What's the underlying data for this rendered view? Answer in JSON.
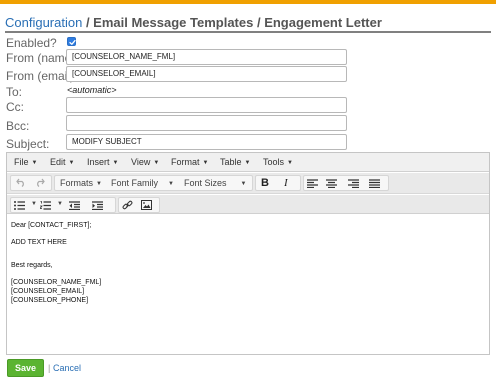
{
  "breadcrumb": {
    "link": "Configuration",
    "sep1": " / ",
    "part2": "Email Message Templates",
    "sep2": " / ",
    "part3": "Engagement Letter"
  },
  "form": {
    "enabled_label": "Enabled?",
    "enabled_checked": true,
    "from_name_label": "From (name):",
    "from_name_value": "[COUNSELOR_NAME_FML]",
    "from_email_label": "From (email):",
    "from_email_value": "[COUNSELOR_EMAIL]",
    "to_label": "To:",
    "to_value": "<automatic>",
    "cc_label": "Cc:",
    "cc_value": "",
    "bcc_label": "Bcc:",
    "bcc_value": "",
    "subject_label": "Subject:",
    "subject_value": "MODIFY SUBJECT"
  },
  "editor": {
    "menus": [
      "File",
      "Edit",
      "Insert",
      "View",
      "Format",
      "Table",
      "Tools"
    ],
    "toolbar": {
      "formats": "Formats",
      "font_family": "Font Family",
      "font_sizes": "Font Sizes",
      "bold": "B",
      "italic": "I"
    },
    "content": {
      "greeting": "Dear [CONTACT_FIRST];",
      "body": "ADD TEXT HERE",
      "closing": "Best regards,",
      "sig1": "[COUNSELOR_NAME_FML]",
      "sig2": "[COUNSELOR_EMAIL]",
      "sig3": "[COUNSELOR_PHONE]"
    }
  },
  "actions": {
    "save": "Save",
    "separator": "|",
    "cancel": "Cancel"
  },
  "colors": {
    "accent_bar": "#f0a000",
    "link": "#2a6fb5",
    "save_button": "#5bb431",
    "checkbox": "#2f7de1"
  }
}
